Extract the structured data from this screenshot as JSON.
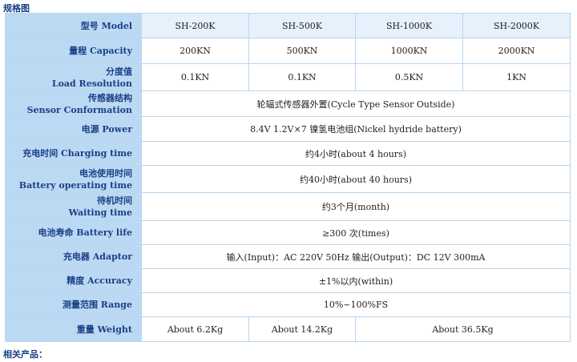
{
  "section_title": "规格图",
  "related_products": "相关产品：",
  "header": {
    "label": "型号 Model",
    "models": [
      "SH-200K",
      "SH-500K",
      "SH-1000K",
      "SH-2000K"
    ]
  },
  "rows": {
    "capacity": {
      "label": "量程  Capacity",
      "values": [
        "200KN",
        "500KN",
        "1000KN",
        "2000KN"
      ]
    },
    "resolution": {
      "label_cn": "分度值",
      "label_en": "Load Resolution",
      "values": [
        "0.1KN",
        "0.1KN",
        "0.5KN",
        "1KN"
      ]
    },
    "sensor": {
      "label_cn": "传感器结构",
      "label_en": "Sensor  Conformation",
      "value": "轮辐式传感器外置(Cycle Type Sensor Outside)"
    },
    "power": {
      "label": "电源  Power",
      "value": "8.4V  1.2V×7 镍氢电池组(Nickel hydride battery)"
    },
    "charging": {
      "label": "充电时间  Charging time",
      "value": "约4小时(about 4 hours)"
    },
    "operating": {
      "label_cn": "电池使用时间",
      "label_en": "Battery operating time",
      "value": "约40小时(about 40 hours)"
    },
    "waiting": {
      "label_cn": "待机时间",
      "label_en": "Waiting time",
      "value": "约3个月(month)"
    },
    "battery_life": {
      "label": "电池寿命  Battery life",
      "value": "≥300 次(times)"
    },
    "adaptor": {
      "label": "充电器  Adaptor",
      "value": "输入(Input)：AC  220V  50Hz   输出(Output)：DC  12V  300mA"
    },
    "accuracy": {
      "label": "精度  Accuracy",
      "value": "±1%以内(within)"
    },
    "range": {
      "label": "测量范围  Range",
      "value": "10%~100%FS"
    },
    "weight": {
      "label": "重量  Weight",
      "values": [
        "About 6.2Kg",
        "About 14.2Kg",
        "About 36.5Kg"
      ]
    }
  }
}
